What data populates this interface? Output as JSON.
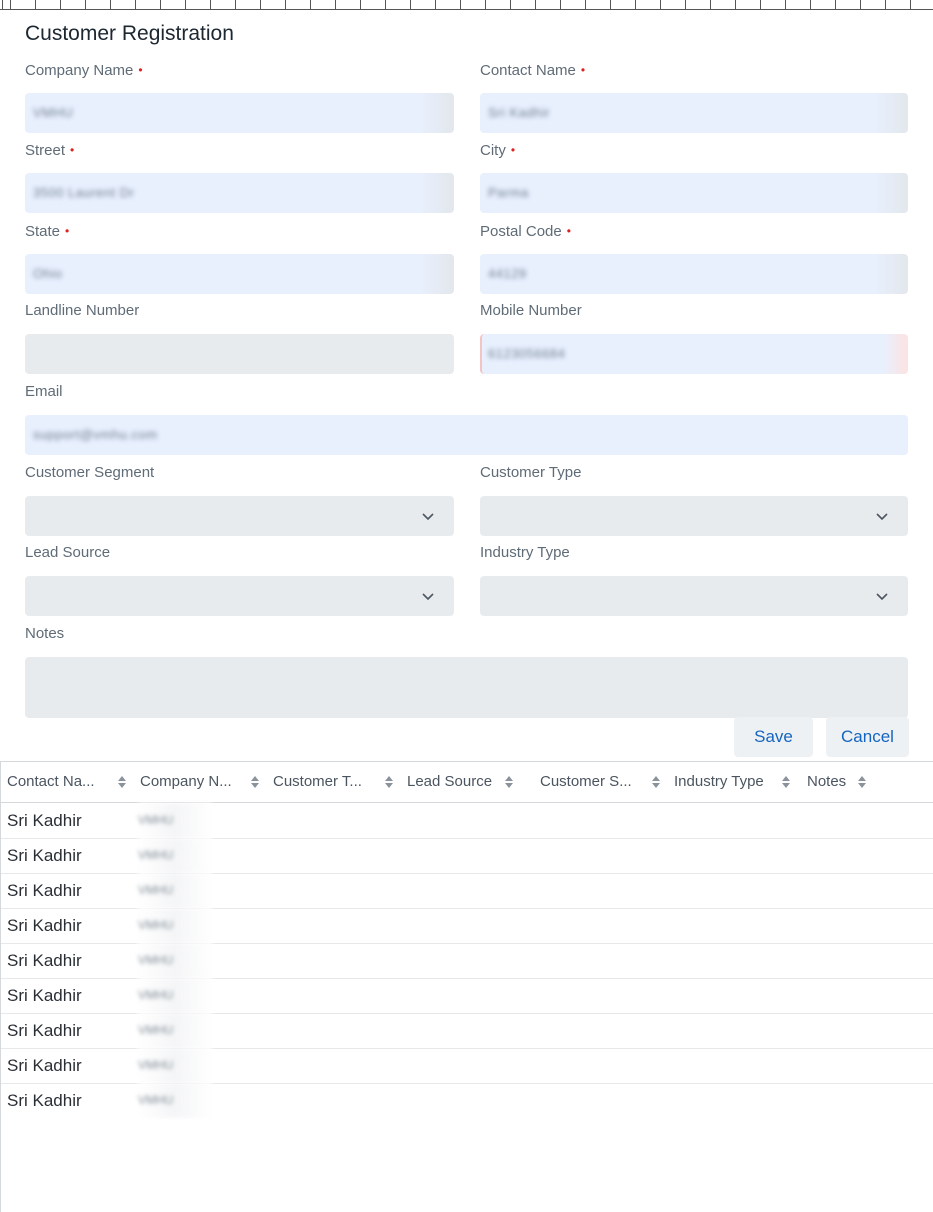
{
  "form": {
    "title": "Customer Registration",
    "fields": {
      "company_name": {
        "label": "Company Name",
        "value": "VMHU"
      },
      "contact_name": {
        "label": "Contact Name",
        "value": "Sri Kadhir"
      },
      "street": {
        "label": "Street",
        "value": "3500 Laurent Dr"
      },
      "city": {
        "label": "City",
        "value": "Parma"
      },
      "state": {
        "label": "State",
        "value": "Ohio"
      },
      "postal_code": {
        "label": "Postal Code",
        "value": "44129"
      },
      "landline_number": {
        "label": "Landline Number",
        "value": ""
      },
      "mobile_number": {
        "label": "Mobile Number",
        "value": "6123056684"
      },
      "email": {
        "label": "Email",
        "value": "support@vmhu.com"
      },
      "customer_segment": {
        "label": "Customer Segment",
        "value": ""
      },
      "customer_type": {
        "label": "Customer Type",
        "value": ""
      },
      "lead_source": {
        "label": "Lead Source",
        "value": ""
      },
      "industry_type": {
        "label": "Industry Type",
        "value": ""
      },
      "notes": {
        "label": "Notes",
        "value": ""
      }
    },
    "required_marker": "•",
    "save_label": "Save",
    "cancel_label": "Cancel"
  },
  "grid": {
    "columns": [
      "Contact Na...",
      "Company N...",
      "Customer T...",
      "Lead Source",
      "Customer S...",
      "Industry Type",
      "Notes"
    ],
    "rows": [
      {
        "contact": "Sri Kadhir",
        "company": "VMHU"
      },
      {
        "contact": "Sri Kadhir",
        "company": "VMHU"
      },
      {
        "contact": "Sri Kadhir",
        "company": "VMHU"
      },
      {
        "contact": "Sri Kadhir",
        "company": "VMHU"
      },
      {
        "contact": "Sri Kadhir",
        "company": "VMHU"
      },
      {
        "contact": "Sri Kadhir",
        "company": "VMHU"
      },
      {
        "contact": "Sri Kadhir",
        "company": "VMHU"
      },
      {
        "contact": "Sri Kadhir",
        "company": "VMHU"
      },
      {
        "contact": "Sri Kadhir",
        "company": "VMHU"
      }
    ]
  },
  "colors": {
    "accent": "#1565c0",
    "required": "#e02020",
    "autofill": "#e8f0fe",
    "input_bg": "#e8ebee"
  },
  "icons": {
    "select": "chevron-down-icon",
    "sort": "sort-icon"
  }
}
